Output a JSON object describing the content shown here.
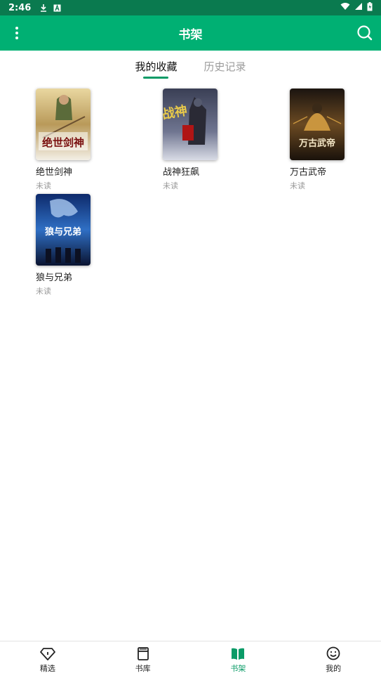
{
  "status_bar": {
    "time": "2:46",
    "icons": [
      "download-icon",
      "app-a-icon",
      "wifi-icon",
      "signal-icon",
      "battery-icon"
    ]
  },
  "app_bar": {
    "title": "书架",
    "menu_icon": "more-vert-icon",
    "search_icon": "search-icon"
  },
  "tabs": [
    {
      "label": "我的收藏",
      "active": true
    },
    {
      "label": "历史记录",
      "active": false
    }
  ],
  "books": [
    {
      "title": "绝世剑神",
      "status": "未读",
      "cover_text": "绝世剑神"
    },
    {
      "title": "战神狂飙",
      "status": "未读",
      "cover_text": "战神"
    },
    {
      "title": "万古武帝",
      "status": "未读",
      "cover_text": "万古武帝"
    },
    {
      "title": "狼与兄弟",
      "status": "未读",
      "cover_text": "狼与兄弟"
    }
  ],
  "bottom_nav": [
    {
      "label": "精选",
      "icon": "diamond-icon",
      "active": false
    },
    {
      "label": "书库",
      "icon": "book-stack-icon",
      "active": false
    },
    {
      "label": "书架",
      "icon": "open-book-icon",
      "active": true
    },
    {
      "label": "我的",
      "icon": "smiley-icon",
      "active": false
    }
  ],
  "colors": {
    "primary": "#00b073",
    "status_bar": "#0a7a4f",
    "accent": "#0a9b67"
  }
}
